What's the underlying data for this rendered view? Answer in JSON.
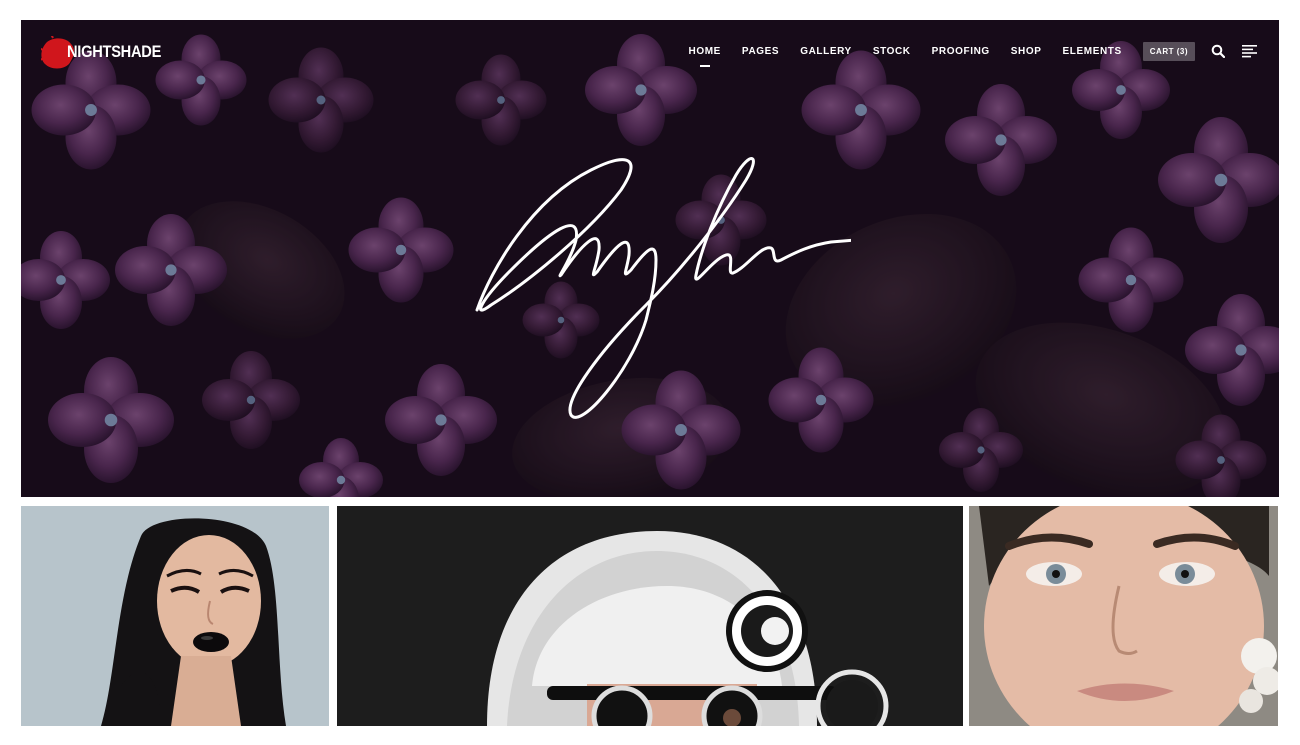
{
  "brand": {
    "name": "NIGHTSHADE",
    "accent_color": "#d0161c"
  },
  "nav": {
    "items": [
      {
        "label": "HOME",
        "active": true
      },
      {
        "label": "PAGES",
        "active": false
      },
      {
        "label": "GALLERY",
        "active": false
      },
      {
        "label": "STOCK",
        "active": false
      },
      {
        "label": "PROOFING",
        "active": false
      },
      {
        "label": "SHOP",
        "active": false
      },
      {
        "label": "ELEMENTS",
        "active": false
      }
    ],
    "cart_label": "CART (3)",
    "search_icon": "search-icon",
    "menu_icon": "hamburger-menu-icon"
  },
  "hero": {
    "background": "purple hydrangea flowers",
    "overlay_color": "#2a1530"
  },
  "gallery": {
    "tiles": [
      {
        "subject": "portrait-black-lipstick"
      },
      {
        "subject": "portrait-white-hair-round-glasses"
      },
      {
        "subject": "portrait-short-hair-woman"
      }
    ]
  }
}
